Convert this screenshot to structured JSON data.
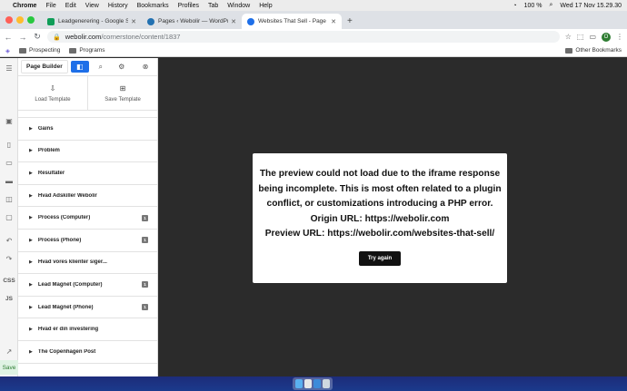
{
  "menubar": {
    "apple": "",
    "items": [
      "Chrome",
      "File",
      "Edit",
      "View",
      "History",
      "Bookmarks",
      "Profiles",
      "Tab",
      "Window",
      "Help"
    ],
    "battery": "100 %",
    "clock": "Wed 17 Nov  15.29.30"
  },
  "tabs": [
    {
      "label": "Leadgenerering - Google Shee",
      "favicon_color": "#0f9d58"
    },
    {
      "label": "Pages ‹ Webolir — WordPress",
      "favicon_color": "#2271b1"
    },
    {
      "label": "Websites That Sell - Page Buil",
      "favicon_color": "#1e6fe8"
    }
  ],
  "address": {
    "host": "webolir.com",
    "path": "/cornerstone/content/1837",
    "profile_initial": "O"
  },
  "bookmarks": {
    "items": [
      "Prospecting",
      "Programs"
    ],
    "other": "Other Bookmarks"
  },
  "rail": {
    "css_label": "CSS",
    "js_label": "JS",
    "save_label": "Save"
  },
  "panel": {
    "title": "Page Builder",
    "load_template": "Load Template",
    "save_template": "Save Template",
    "sections": [
      {
        "label": "Gains",
        "badge": ""
      },
      {
        "label": "Problem",
        "badge": ""
      },
      {
        "label": "Resultater",
        "badge": ""
      },
      {
        "label": "Hvad Adskiller Webolir",
        "badge": ""
      },
      {
        "label": "Process (Computer)",
        "badge": "1"
      },
      {
        "label": "Process (Phone)",
        "badge": "1"
      },
      {
        "label": "Hvad vores klienter siger...",
        "badge": ""
      },
      {
        "label": "Lead Magnet (Computer)",
        "badge": "1"
      },
      {
        "label": "Lead Magnet (Phone)",
        "badge": "1"
      },
      {
        "label": "Hvad er din investering",
        "badge": ""
      },
      {
        "label": "The Copenhagen Post",
        "badge": ""
      }
    ]
  },
  "preview_error": {
    "lines": [
      "The preview could not load due to the iframe response",
      "being incomplete. This is most often related to a plugin",
      "conflict, or customizations introducing a PHP error.",
      "Origin URL: https://webolir.com",
      "Preview URL: https://webolir.com/websites-that-sell/"
    ],
    "button": "Try again"
  }
}
